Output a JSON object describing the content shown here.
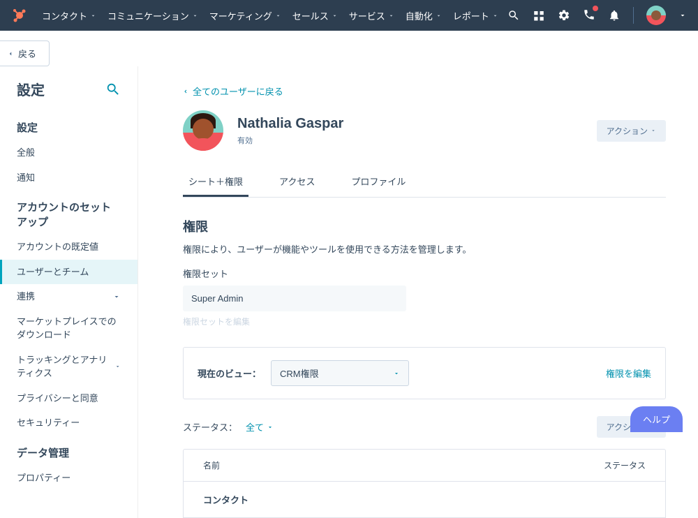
{
  "nav": {
    "items": [
      "コンタクト",
      "コミュニケーション",
      "マーケティング",
      "セールス",
      "サービス",
      "自動化",
      "レポート"
    ]
  },
  "back": "戻る",
  "sidebar": {
    "title": "設定",
    "sections": [
      {
        "title": "設定",
        "items": [
          {
            "label": "全般"
          },
          {
            "label": "通知"
          }
        ]
      },
      {
        "title": "アカウントのセットアップ",
        "items": [
          {
            "label": "アカウントの既定値"
          },
          {
            "label": "ユーザーとチーム",
            "active": true
          },
          {
            "label": "連携",
            "chev": true
          },
          {
            "label": "マーケットプレイスでのダウンロード"
          },
          {
            "label": "トラッキングとアナリティクス",
            "chev": true
          },
          {
            "label": "プライバシーと同意"
          },
          {
            "label": "セキュリティー"
          }
        ]
      },
      {
        "title": "データ管理",
        "items": [
          {
            "label": "プロパティー"
          }
        ]
      }
    ]
  },
  "main": {
    "backLink": "全てのユーザーに戻る",
    "userName": "Nathalia Gaspar",
    "userStatus": "有効",
    "actionLabel": "アクション",
    "tabs": [
      "シート＋権限",
      "アクセス",
      "プロファイル"
    ],
    "permTitle": "権限",
    "permDesc": "権限により、ユーザーが機能やツールを使用できる方法を管理します。",
    "permSetLabel": "権限セット",
    "permSetValue": "Super Admin",
    "editSet": "権限セットを編集",
    "viewLabel": "現在のビュー：",
    "viewValue": "CRM権限",
    "editPerm": "権限を編集",
    "statusLabel": "ステータス：",
    "statusAll": "全て",
    "tableCols": {
      "name": "名前",
      "status": "ステータス"
    },
    "tableRow": "コンタクト"
  },
  "help": "ヘルプ"
}
